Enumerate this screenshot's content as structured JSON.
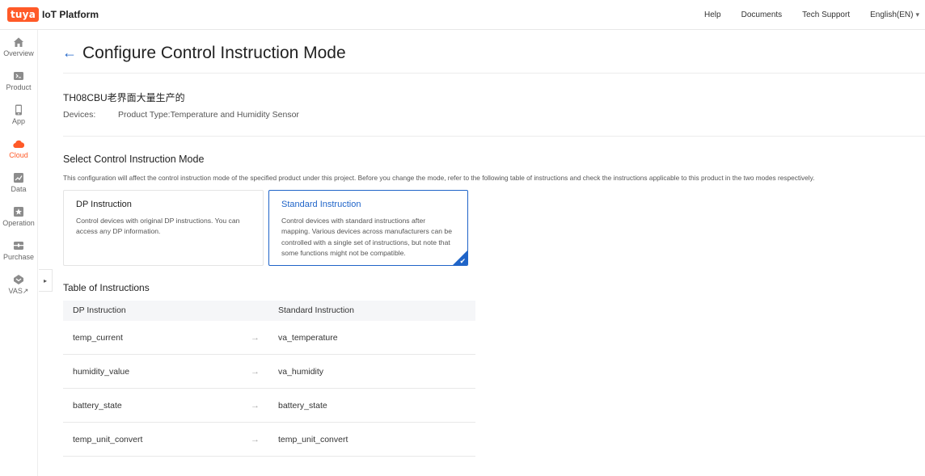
{
  "brand": {
    "logo": "tuya",
    "product": "IoT Platform"
  },
  "top_nav": [
    "Help",
    "Documents",
    "Tech Support",
    "English(EN)"
  ],
  "sidebar": {
    "items": [
      {
        "label": "Overview",
        "icon": "home-icon"
      },
      {
        "label": "Product",
        "icon": "terminal-icon"
      },
      {
        "label": "App",
        "icon": "phone-icon"
      },
      {
        "label": "Cloud",
        "icon": "cloud-icon",
        "active": true
      },
      {
        "label": "Data",
        "icon": "chart-icon"
      },
      {
        "label": "Operation",
        "icon": "star-icon"
      },
      {
        "label": "Purchase",
        "icon": "cart-icon"
      },
      {
        "label": "VAS↗",
        "icon": "vas-icon"
      }
    ],
    "collapse_toggle": "▸"
  },
  "page": {
    "back": "←",
    "title": "Configure Control Instruction Mode",
    "product_name": "TH08CBU老界面大量生产的",
    "devices_label": "Devices:",
    "product_type": "Product Type:Temperature and Humidity Sensor",
    "section_title": "Select Control Instruction Mode",
    "section_desc": "This configuration will affect the control instruction mode of the specified product under this project. Before you change the mode, refer to the following table of instructions and check the instructions applicable to this product in the two modes respectively."
  },
  "modes": [
    {
      "title": "DP Instruction",
      "desc": "Control devices with original DP instructions. You can access any DP information.",
      "selected": false
    },
    {
      "title": "Standard Instruction",
      "desc": "Control devices with standard instructions after mapping. Various devices across manufacturers can be controlled with a single set of instructions, but note that some functions might not be compatible.",
      "selected": true
    }
  ],
  "table": {
    "title": "Table of Instructions",
    "headers": [
      "DP Instruction",
      "Standard Instruction"
    ],
    "arrow": "→",
    "rows": [
      [
        "temp_current",
        "va_temperature"
      ],
      [
        "humidity_value",
        "va_humidity"
      ],
      [
        "battery_state",
        "battery_state"
      ],
      [
        "temp_unit_convert",
        "temp_unit_convert"
      ]
    ]
  },
  "colors": {
    "brand": "#ff5a28",
    "accent": "#1f64c8"
  }
}
